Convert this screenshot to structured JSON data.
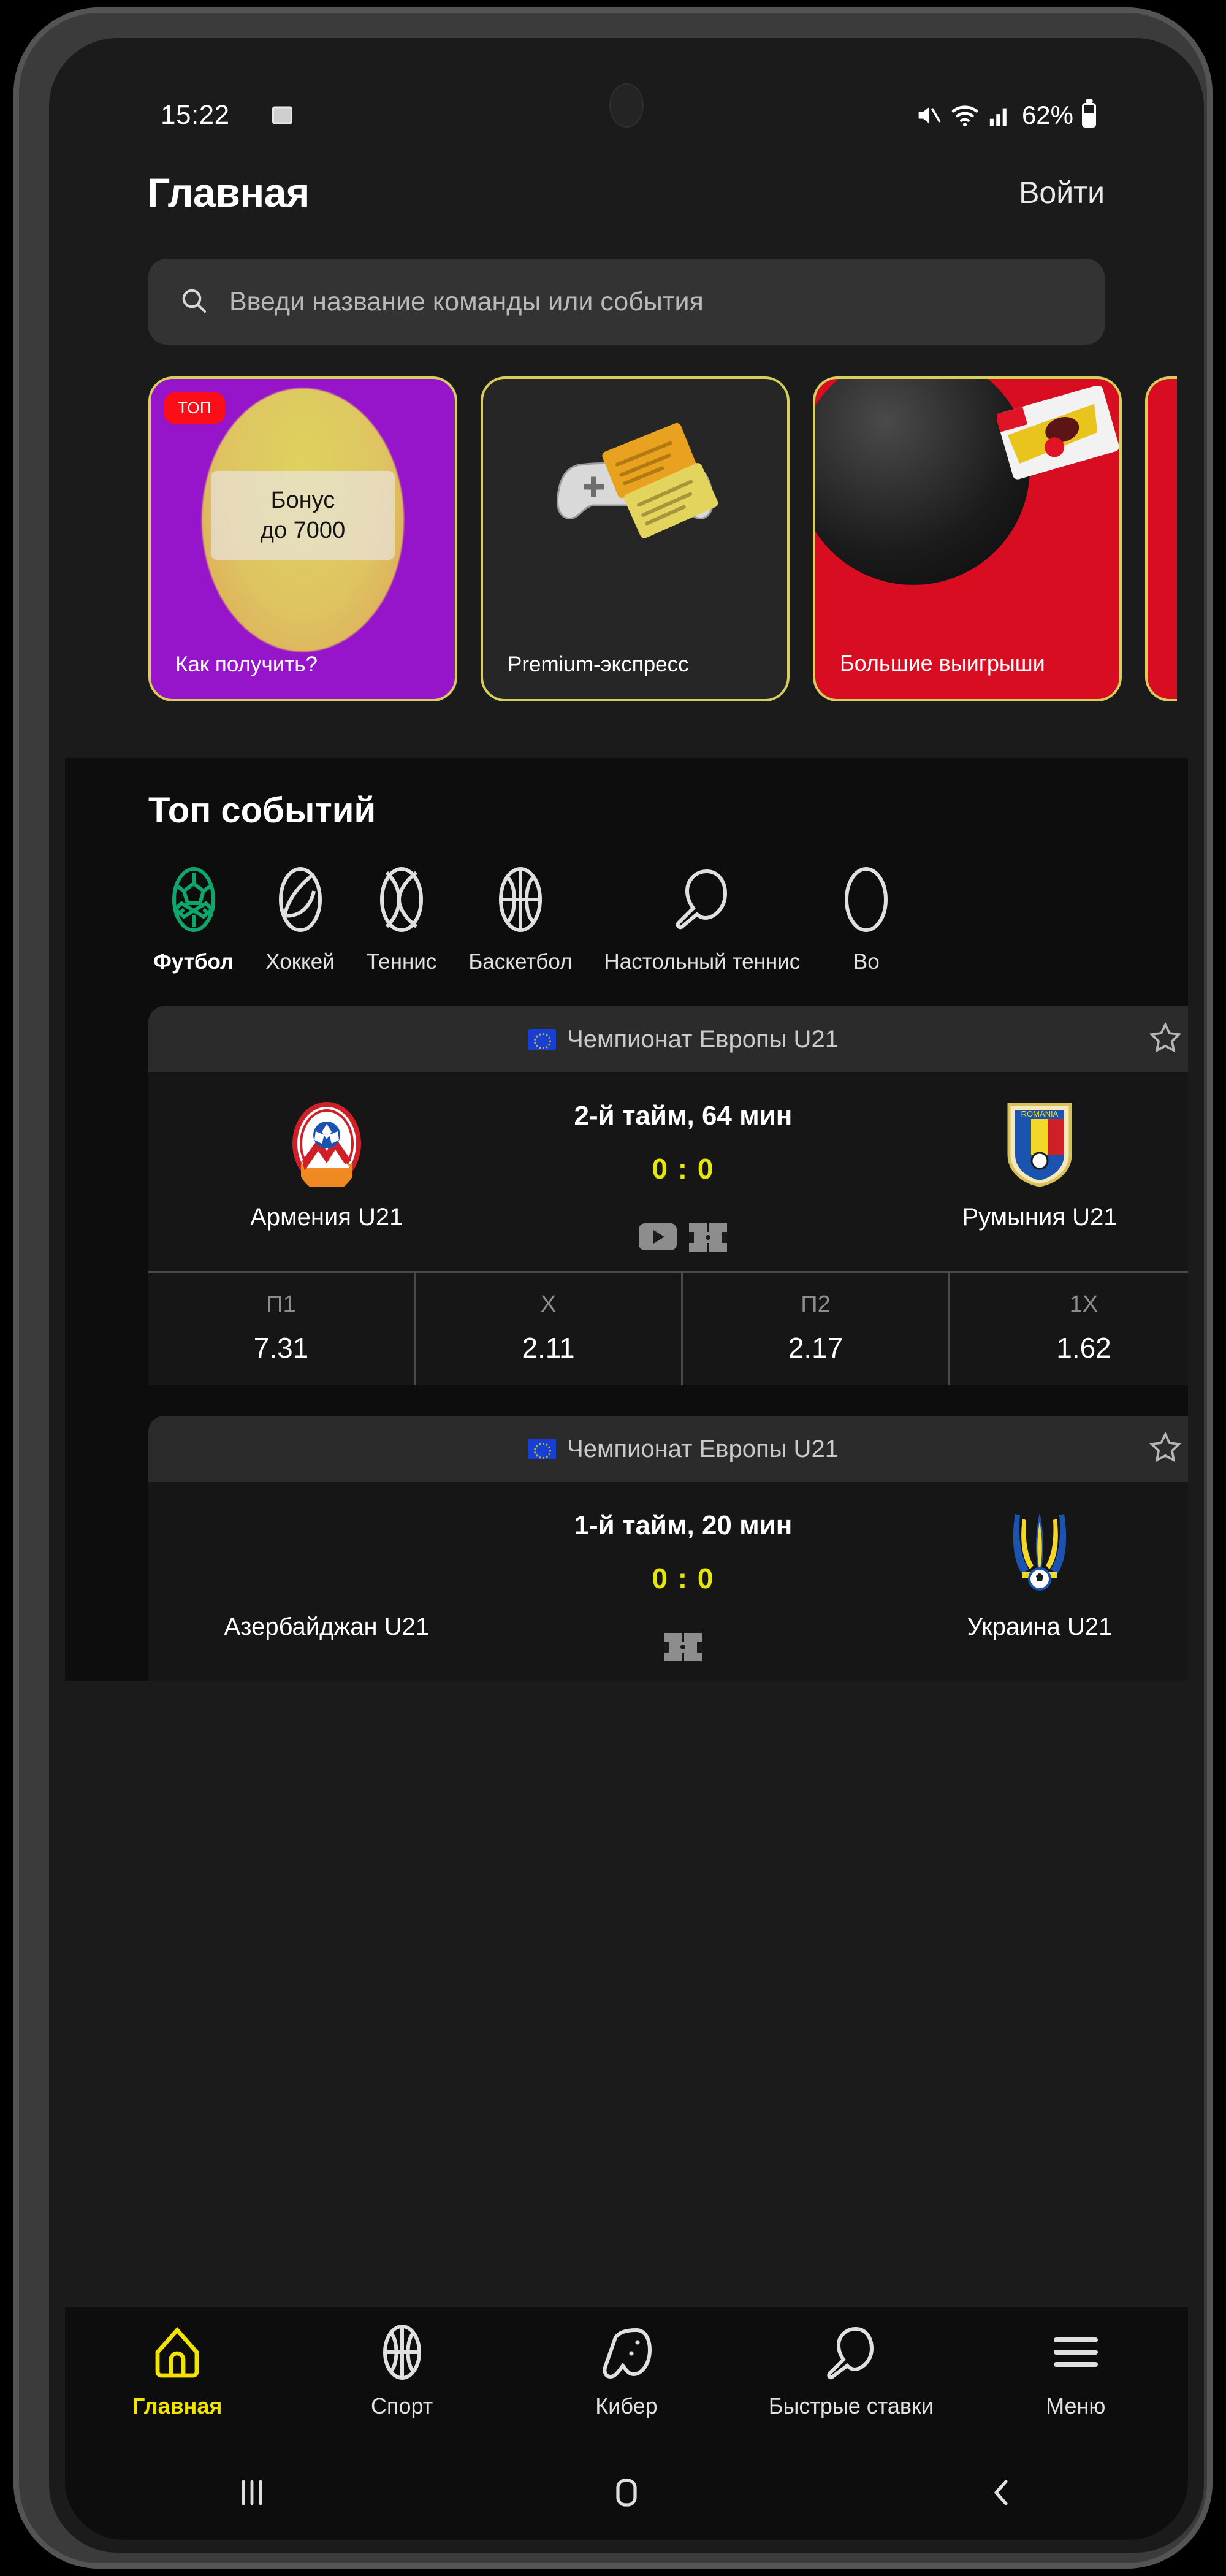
{
  "status_bar": {
    "time": "15:22",
    "photo_icon": "image-icon",
    "mute_icon": "mute-icon",
    "wifi_icon": "wifi-icon",
    "signal_icon": "signal-bars-icon",
    "battery_percent": "62%",
    "battery_icon": "battery-icon"
  },
  "header": {
    "title": "Главная",
    "login_label": "Войти"
  },
  "search": {
    "placeholder": "Введи название команды или события",
    "icon": "search-icon"
  },
  "promos": {
    "cards": [
      {
        "badge": "ТОП",
        "headline_line1": "Бонус",
        "headline_line2": "до 7000",
        "label": "Как получить?",
        "color": "#9614c9"
      },
      {
        "badge": "",
        "headline_line1": "",
        "headline_line2": "",
        "label": "Premium-экспресс",
        "color": "#262626"
      },
      {
        "badge": "",
        "headline_line1": "",
        "headline_line2": "",
        "label": "Большие выигрыши",
        "color": "#d80d22"
      }
    ]
  },
  "top_events": {
    "title": "Топ событий",
    "sports": [
      {
        "label": "Футбол",
        "icon": "football-icon",
        "active": true
      },
      {
        "label": "Хоккей",
        "icon": "hockey-puck-icon",
        "active": false
      },
      {
        "label": "Теннис",
        "icon": "tennis-ball-icon",
        "active": false
      },
      {
        "label": "Баскетбол",
        "icon": "basketball-icon",
        "active": false
      },
      {
        "label": "Настольный теннис",
        "icon": "table-tennis-icon",
        "active": false
      },
      {
        "label": "Во",
        "icon": "volleyball-icon",
        "active": false
      }
    ],
    "matches": [
      {
        "league": "Чемпионат Европы U21",
        "league_flag": "eu-flag-icon",
        "favorite_icon": "star-outline-icon",
        "period": "2-й тайм, 64 мин",
        "score": "0 : 0",
        "home_team": "Армения U21",
        "away_team": "Румыния U21",
        "home_logo": "armenia-crest-icon",
        "away_logo": "romania-crest-icon",
        "media_icons": [
          "video-icon",
          "pitch-stats-icon"
        ],
        "odds": [
          {
            "key": "П1",
            "value": "7.31"
          },
          {
            "key": "X",
            "value": "2.11"
          },
          {
            "key": "П2",
            "value": "2.17"
          },
          {
            "key": "1X",
            "value": "1.62"
          }
        ]
      },
      {
        "league": "Чемпионат Европы U21",
        "league_flag": "eu-flag-icon",
        "favorite_icon": "star-outline-icon",
        "period": "1-й тайм, 20 мин",
        "score": "0 : 0",
        "home_team": "Азербайджан U21",
        "away_team": "Украина U21",
        "home_logo": "",
        "away_logo": "ukraine-trident-icon",
        "media_icons": [
          "pitch-stats-icon"
        ],
        "odds": []
      }
    ]
  },
  "bottom_nav": {
    "items": [
      {
        "label": "Главная",
        "icon": "home-icon",
        "active": true
      },
      {
        "label": "Спорт",
        "icon": "basketball-icon",
        "active": false
      },
      {
        "label": "Кибер",
        "icon": "gamepad-icon",
        "active": false
      },
      {
        "label": "Быстрые ставки",
        "icon": "table-tennis-icon",
        "active": false
      },
      {
        "label": "Меню",
        "icon": "hamburger-menu-icon",
        "active": false
      }
    ],
    "accent_color": "#f2e300"
  },
  "android_nav": {
    "recents_icon": "recents-icon",
    "home_icon": "home-square-icon",
    "back_icon": "back-chevron-icon"
  }
}
